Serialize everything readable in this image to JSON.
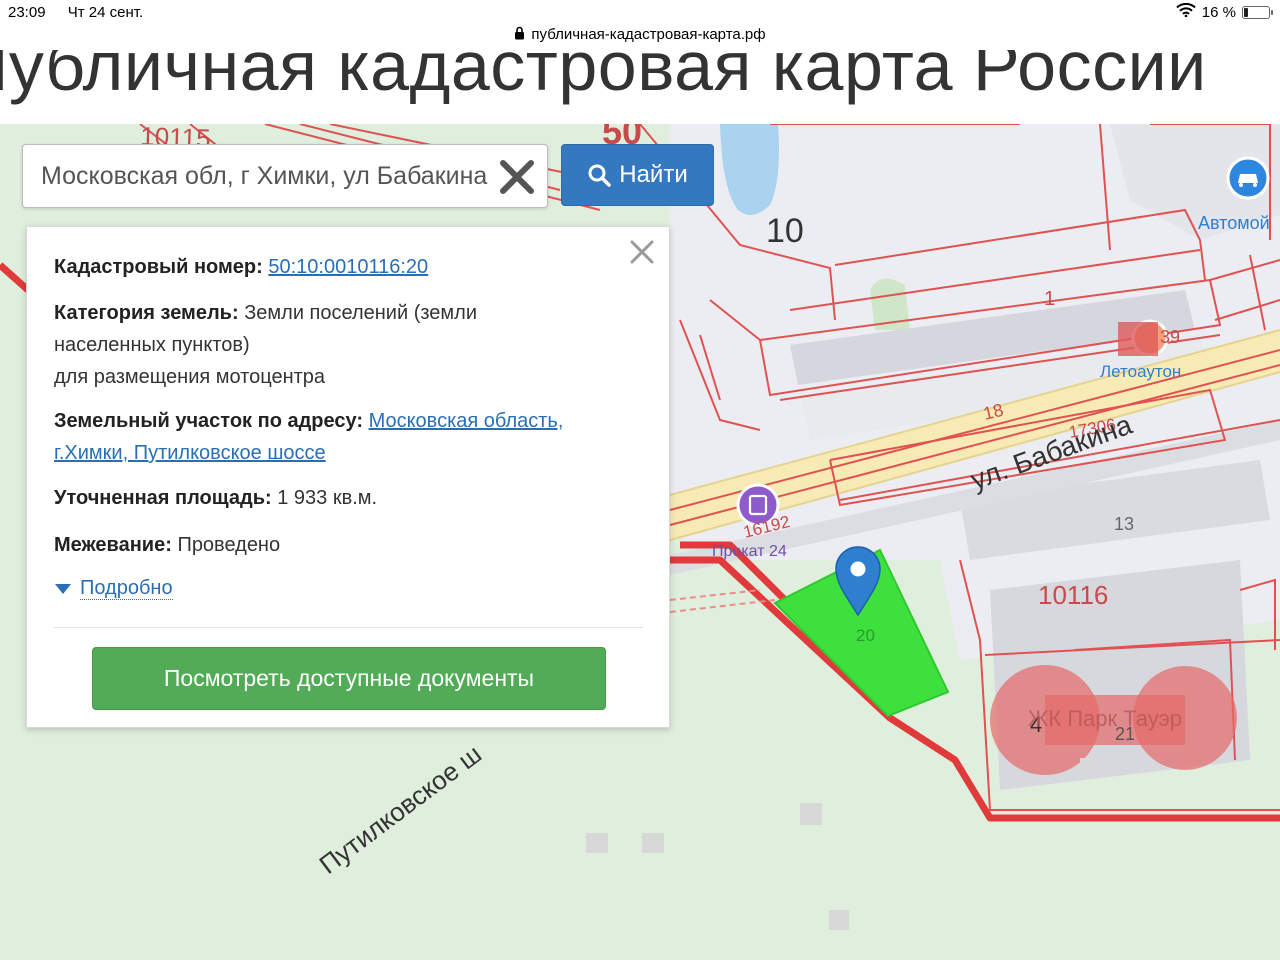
{
  "status_bar": {
    "time": "23:09",
    "date": "Чт 24 сент.",
    "url": "публичная-кадастровая-карта.рф",
    "battery": "16 %",
    "battery_level": 0.16
  },
  "header": {
    "title": "Публичная кадастровая карта России"
  },
  "search": {
    "value": "Московская обл, г Химки, ул Бабакина",
    "find_label": "Найти"
  },
  "info": {
    "cadastral_label": "Кадастровый номер:",
    "cadastral_number": "50:10:0010116:20",
    "category_label": "Категория земель:",
    "category_value_1": "Земли поселений (земли",
    "category_value_2": "населенных пунктов)",
    "category_value_3": "для размещения мотоцентра",
    "address_label": "Земельный участок по адресу:",
    "address_value_1": "Московская область,",
    "address_value_2": "г.Химки, Путилковское шоссе",
    "area_label": "Уточненная площадь:",
    "area_value": "1 933 кв.м.",
    "survey_label": "Межевание:",
    "survey_value": "Проведено",
    "details_label": "Подробно",
    "docs_button": "Посмотреть доступные документы"
  },
  "map": {
    "labels": {
      "q10115": "10115",
      "q50": "50",
      "q10": "10",
      "n1": "1",
      "n39": "39",
      "n18": "18",
      "n17306": "17306",
      "n13": "13",
      "n16192": "16192",
      "q10116": "10116",
      "n20": "20",
      "n4": "4",
      "n21": "21",
      "street_babakina": "ул. Бабакина",
      "street_putilkovskoe": "Путилковское ш",
      "poi_automoy": "Автомой",
      "poi_letoauton": "Летоаутон",
      "poi_prokat": "Прокат 24",
      "poi_park_tower": "ЖК Парк Тауэр"
    },
    "colors": {
      "map_bg": "#dfeedd",
      "boundary_red": "#e03a3a",
      "parcel_green": "#3ee03e",
      "marker_blue": "#2f7fd0"
    }
  }
}
